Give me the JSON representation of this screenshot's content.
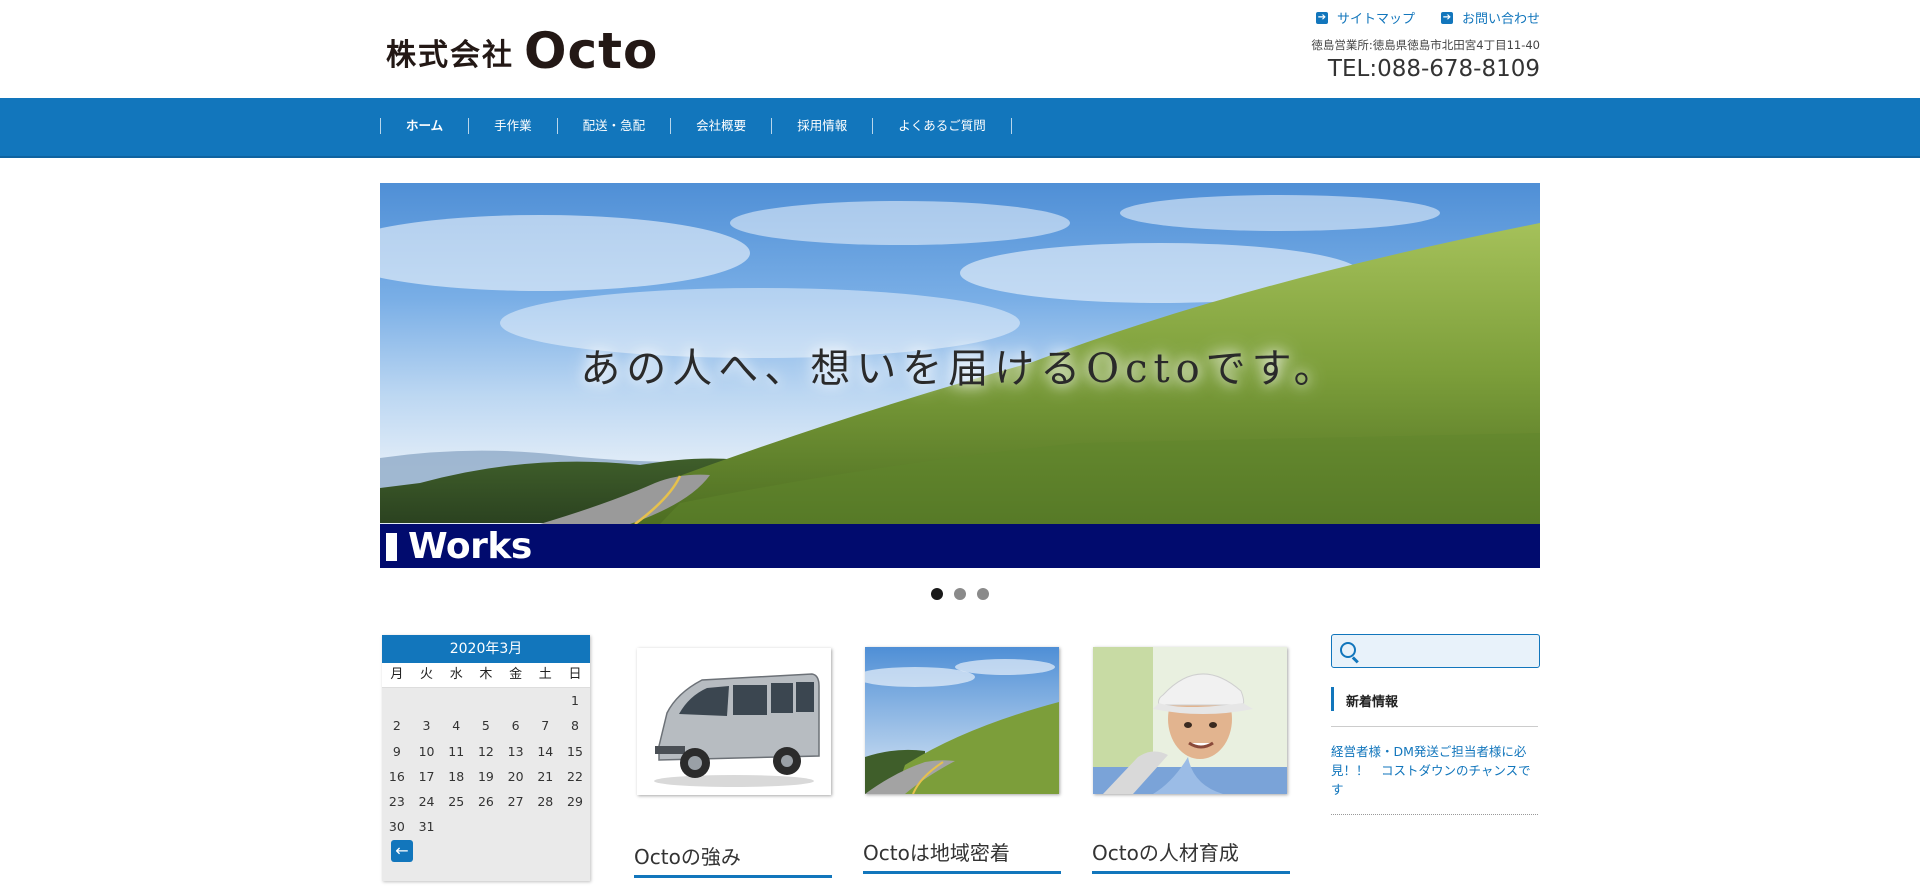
{
  "header": {
    "logo_ja": "株式会社",
    "logo_en": "Octo",
    "links": [
      "サイトマップ",
      "お問い合わせ"
    ],
    "address": "徳島営業所:徳島県徳島市北田宮4丁目11-40",
    "tel": "TEL:088-678-8109"
  },
  "nav": {
    "items": [
      "ホーム",
      "手作業",
      "配送・急配",
      "会社概要",
      "採用情報",
      "よくあるご質問"
    ]
  },
  "hero": {
    "tagline": "あの人へ、想いを届けるOctoです。",
    "banner": "Works"
  },
  "slider": {
    "count": 3,
    "active": 1
  },
  "calendar": {
    "title": "2020年3月",
    "weekdays": [
      "月",
      "火",
      "水",
      "木",
      "金",
      "土",
      "日"
    ],
    "rows": [
      [
        "",
        "",
        "",
        "",
        "",
        "",
        "1"
      ],
      [
        "2",
        "3",
        "4",
        "5",
        "6",
        "7",
        "8"
      ],
      [
        "9",
        "10",
        "11",
        "12",
        "13",
        "14",
        "15"
      ],
      [
        "16",
        "17",
        "18",
        "19",
        "20",
        "21",
        "22"
      ],
      [
        "23",
        "24",
        "25",
        "26",
        "27",
        "28",
        "29"
      ],
      [
        "30",
        "31",
        "",
        "",
        "",
        "",
        ""
      ]
    ],
    "prev_icon": "arrow-left-icon"
  },
  "cards": [
    {
      "title": "Octoの強み",
      "image": "van-photo"
    },
    {
      "title": "Octoは地域密着",
      "image": "road-hill-photo"
    },
    {
      "title": "Octoの人材育成",
      "image": "worker-photo"
    }
  ],
  "sidebar": {
    "search_placeholder": "",
    "news_title": "新着情報",
    "news_items": [
      "経営者様・DM発送ご担当者様に必見！！　コストダウンのチャンスです"
    ]
  },
  "colors": {
    "accent": "#1276bc",
    "banner": "#010b6e"
  }
}
